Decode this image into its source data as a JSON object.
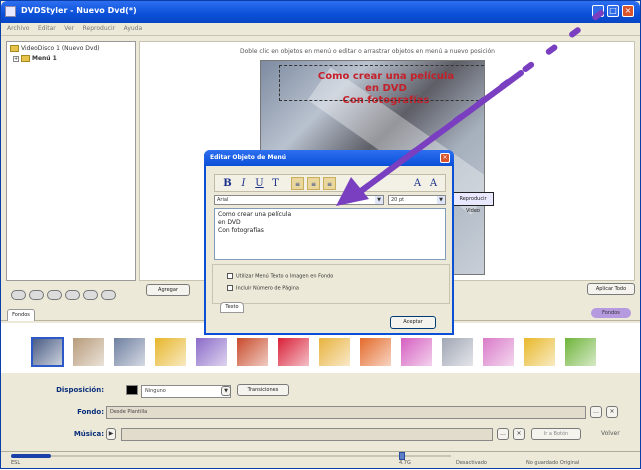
{
  "window": {
    "title": "DVDStyler - Nuevo Dvd(*)",
    "minimize_glyph": "_",
    "maximize_glyph": "□",
    "close_glyph": "×"
  },
  "menubar": {
    "items": [
      "Archivo",
      "Editar",
      "Ver",
      "Reproducir",
      "Ayuda"
    ]
  },
  "tree": {
    "root_label": "VideoDisco 1 (Nuevo Dvd)",
    "menu_label": "Menú 1"
  },
  "preview": {
    "instruction": "Doble clic en objetos en menú o editar o arrastrar objetos en menú a nuevo posición",
    "menu_title": "Como crear una película\nen DVD\nCon fotografías",
    "button_label": "Reproducir Video"
  },
  "dialog": {
    "title": "Editar Objeto de Menú",
    "close_glyph": "×",
    "fmt": {
      "bold": "B",
      "italic": "I",
      "underline": "U",
      "strike": "T",
      "align_left": "≡",
      "align_center": "≡",
      "align_right": "≡",
      "size_up": "A",
      "size_down": "A"
    },
    "font_name": "Arial",
    "font_size": "20 pt",
    "dd_glyph": "▼",
    "text": "Como crear una película\nen DVD\nCon fotografías",
    "checkbox_1": "Utilizar Menú Texto o Imagen en Fondo",
    "checkbox_2": "Incluir Número de Página",
    "tab_label": "Texto",
    "ok_label": "Aceptar"
  },
  "left_buttons": {
    "agregar": "Agregar",
    "round_count": 6
  },
  "right_buttons": {
    "apply": "Aplicar Todo",
    "pill": "Fondos"
  },
  "lower_tab": "Fondos",
  "filmstrip": {
    "thumb_colors": [
      "#4a5d85",
      "#b79b7a",
      "#6e7fa0",
      "#e7b62a",
      "#8a6ac8",
      "#c84a2a",
      "#d92038",
      "#e8b23e",
      "#e46a2a",
      "#d55fc0",
      "#a0a6b4",
      "#d97ac8",
      "#e8b82a",
      "#6fb43a"
    ]
  },
  "form": {
    "disposicion_label": "Disposición:",
    "disposicion_value": "Ninguno",
    "transitions_button": "Transiciones",
    "fondo_label": "Fondo:",
    "fondo_value": "Desde Plantilla",
    "musica_label": "Música:",
    "musica_value": "",
    "browse_glyph": "…",
    "clear_glyph": "×",
    "play_glyph": "▶",
    "nav_button": "Ir a Botón",
    "extra_label": "Volver"
  },
  "status": {
    "left": "ESL",
    "mid": "4.7G",
    "right_a": "Desactivado",
    "right_b": "No guardado Original"
  },
  "colors": {
    "titlebar": "#0a50d8",
    "accent_purple": "#7a3fc0",
    "menu_title": "#c51f2a",
    "window_bg": "#ece9d8"
  }
}
